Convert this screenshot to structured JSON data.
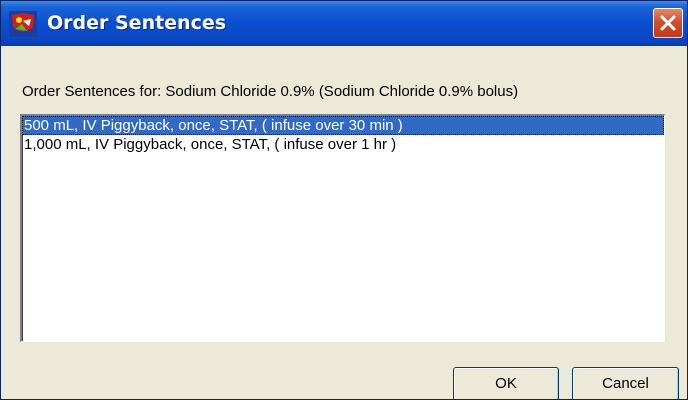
{
  "window": {
    "title": "Order Sentences",
    "app_icon": "red-shield-app-icon",
    "close_icon": "close-icon",
    "accent_color": "#0a4fd0"
  },
  "header": {
    "label": "Order Sentences for:  Sodium Chloride 0.9% (Sodium Chloride 0.9% bolus)"
  },
  "sentences": [
    {
      "text": "500 mL, IV Piggyback, once, STAT, ( infuse over 30 min )",
      "selected": true
    },
    {
      "text": "1,000 mL, IV Piggyback, once, STAT, ( infuse over 1 hr )",
      "selected": false
    }
  ],
  "buttons": {
    "ok": "OK",
    "cancel": "Cancel"
  }
}
